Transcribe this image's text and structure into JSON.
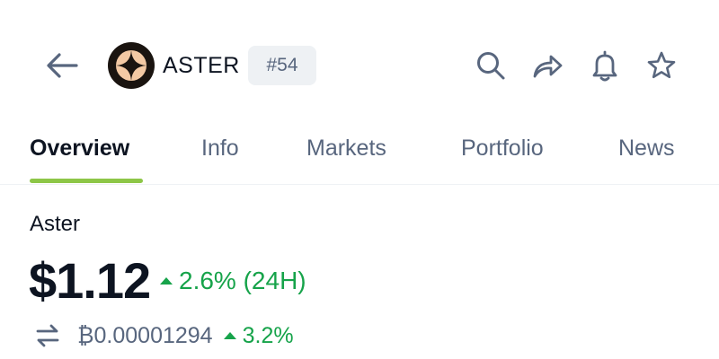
{
  "header": {
    "back_icon": "arrow-left-icon",
    "logo_icon": "aster-logo",
    "ticker": "ASTER",
    "rank": "#54",
    "actions": {
      "search_icon": "search-icon",
      "share_icon": "share-icon",
      "alert_icon": "bell-icon",
      "watchlist_icon": "star-icon"
    }
  },
  "tabs": [
    {
      "label": "Overview",
      "active": true
    },
    {
      "label": "Info",
      "active": false
    },
    {
      "label": "Markets",
      "active": false
    },
    {
      "label": "Portfolio",
      "active": false
    },
    {
      "label": "News",
      "active": false
    }
  ],
  "coin": {
    "name": "Aster",
    "price": "$1.12",
    "change_24h": "2.6% (24H)",
    "btc_price": "₿0.00001294",
    "btc_change": "3.2%"
  },
  "colors": {
    "accent_green": "#8dc647",
    "positive": "#16a34a",
    "text_primary": "#0d1421",
    "text_secondary": "#58667e",
    "logo_bg": "#1a1410",
    "logo_star": "#f3c9a4"
  }
}
